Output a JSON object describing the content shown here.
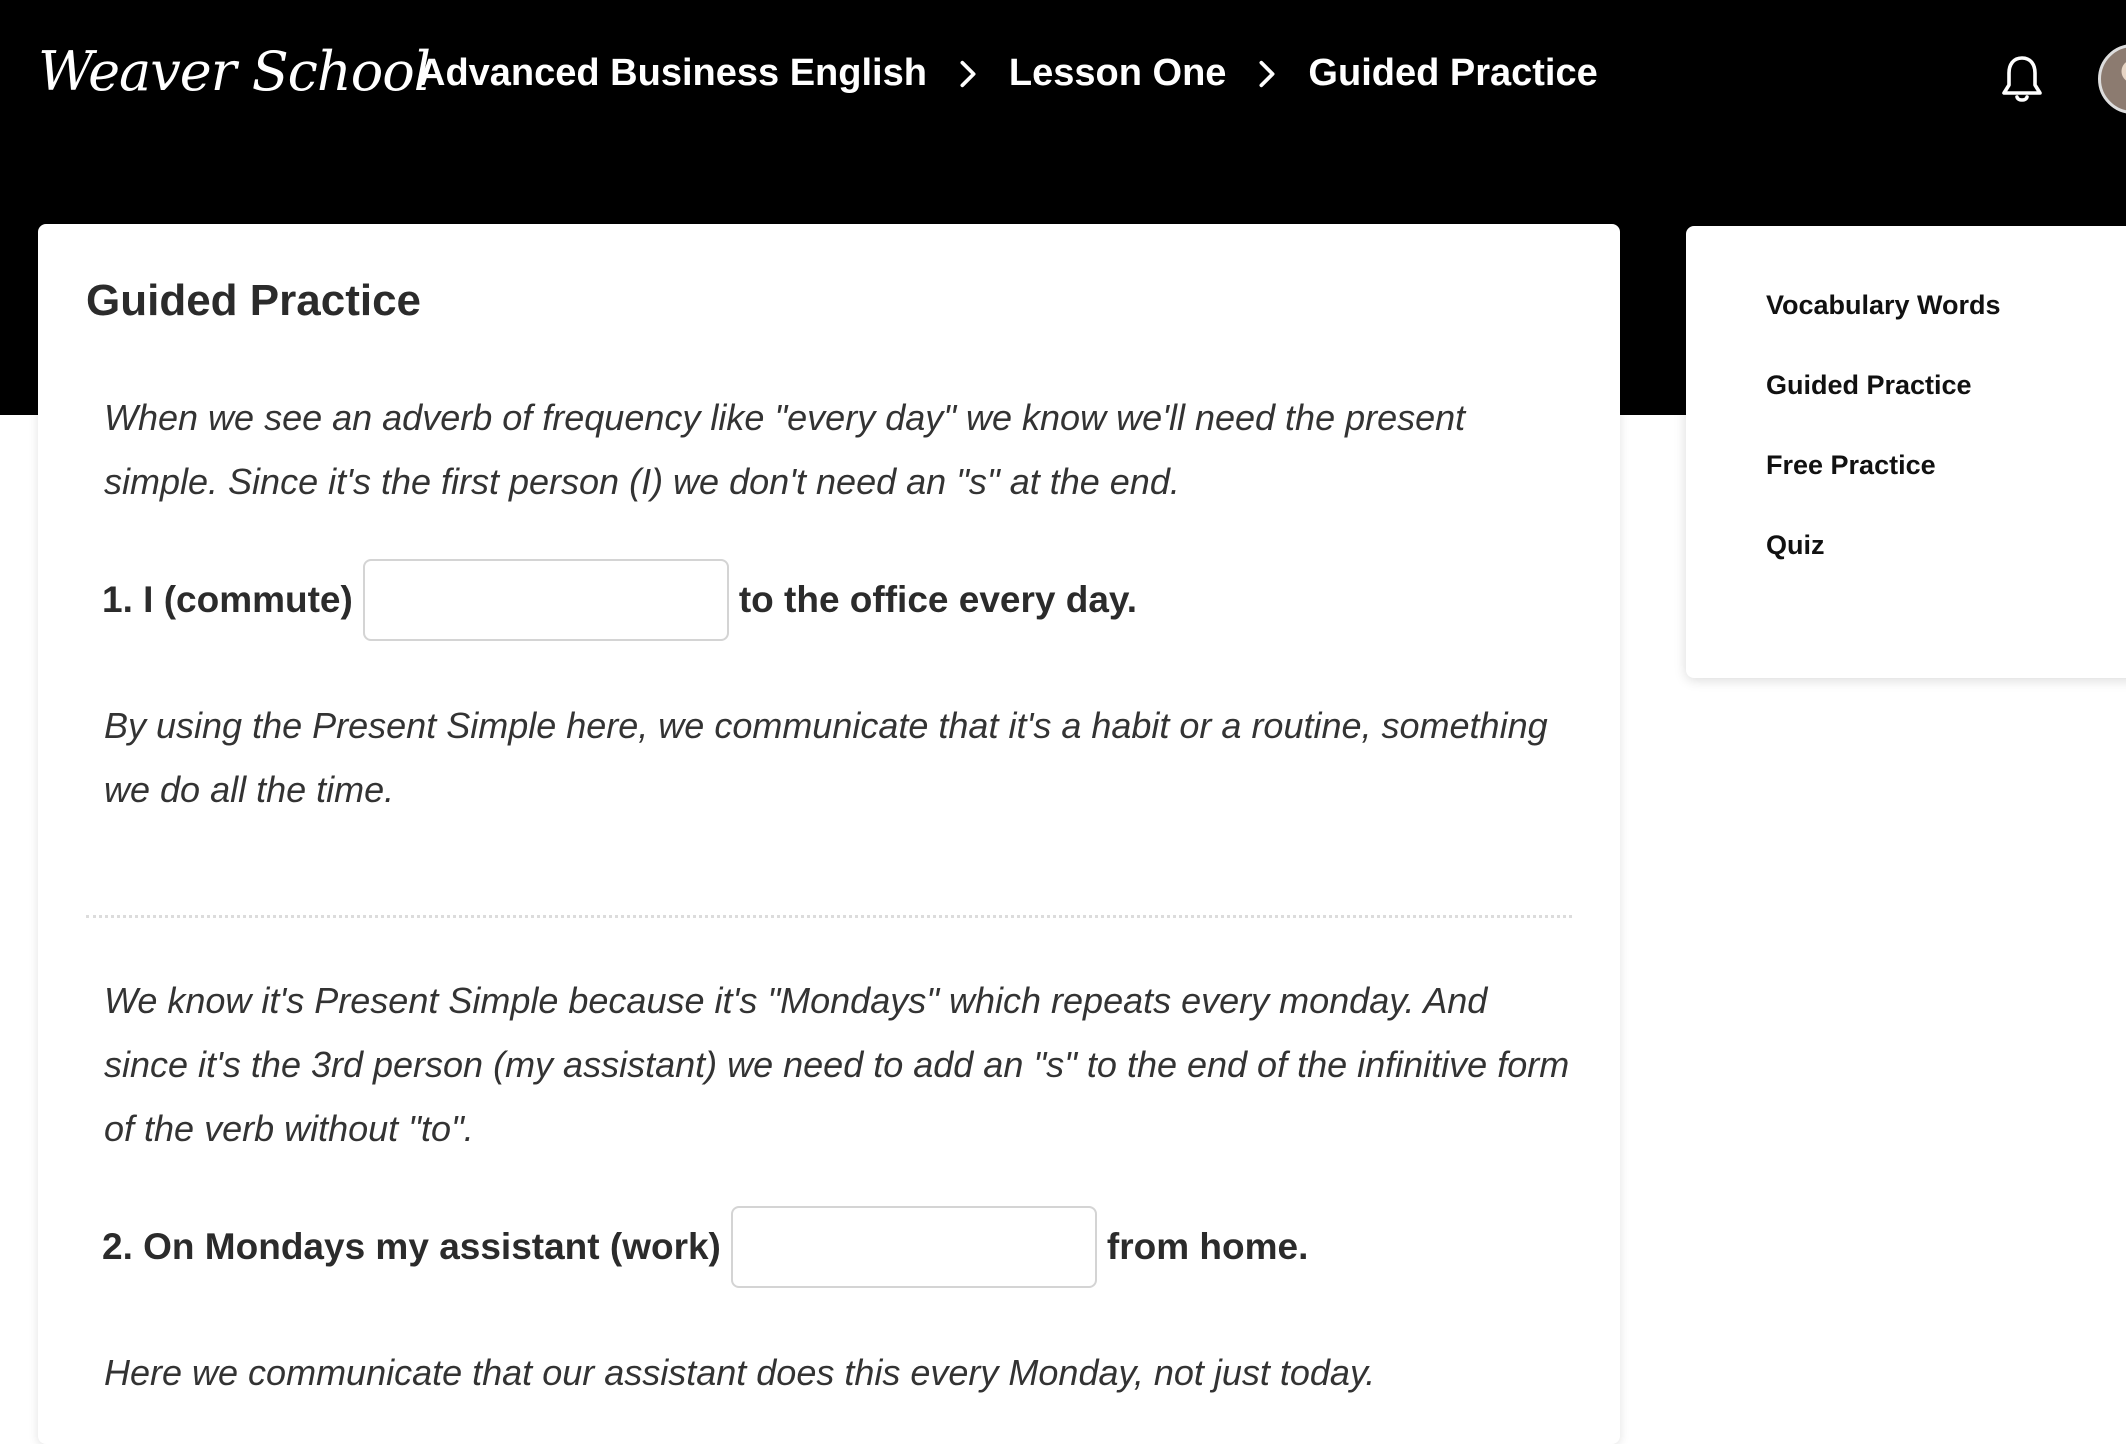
{
  "header": {
    "logo": "Weaver School",
    "breadcrumb": [
      "Advanced Business English",
      "Lesson One",
      "Guided Practice"
    ]
  },
  "main": {
    "title": "Guided Practice",
    "sections": [
      {
        "explanation_before": "When we see an adverb of frequency like \"every day\" we know we'll need the present simple. Since it's the first person (I) we don't need an \"s\" at the end.",
        "question_prefix": "1. I (commute)",
        "answer_value": "",
        "question_suffix": "to the office every day.",
        "explanation_after": "By using the Present Simple here, we communicate that it's a habit or a routine, something we do all the time."
      },
      {
        "explanation_before": "We know it's Present Simple because it's \"Mondays\" which repeats every monday. And since it's the 3rd person (my assistant) we need to add an \"s\" to the end of the infinitive form of the verb without \"to\".",
        "question_prefix": "2. On Mondays my assistant (work)",
        "answer_value": "",
        "question_suffix": "from home.",
        "explanation_after": "Here we communicate that our assistant does this every Monday, not just today."
      }
    ]
  },
  "sidebar": {
    "items": [
      {
        "label": "Vocabulary Words"
      },
      {
        "label": "Guided Practice"
      },
      {
        "label": "Free Practice"
      },
      {
        "label": "Quiz"
      }
    ]
  },
  "colors": {
    "header_bg": "#000000",
    "card_bg": "#ffffff",
    "text": "#2b2b2b"
  },
  "icons": [
    "chevron-right-icon",
    "bell-icon",
    "avatar"
  ]
}
